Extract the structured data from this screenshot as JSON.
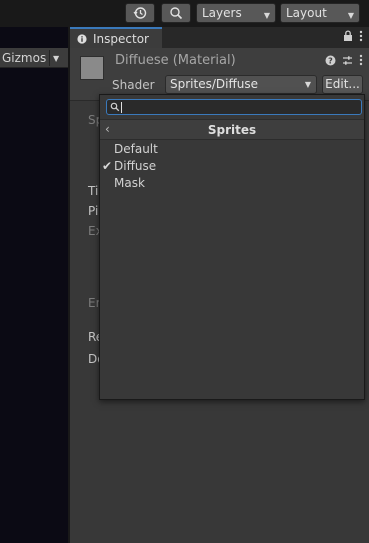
{
  "toolbar": {
    "layers_label": "Layers",
    "layout_label": "Layout"
  },
  "scene": {
    "gizmos_label": "Gizmos"
  },
  "inspector": {
    "tab_label": "Inspector",
    "material_title": "Diffuese (Material)",
    "shader_label": "Shader",
    "shader_value": "Sprites/Diffuse",
    "edit_label": "Edit..."
  },
  "body_labels": {
    "l1": "Sp",
    "l2": "Ti",
    "l3": "Pi",
    "l4": "Ex",
    "l5": "Er",
    "l6": "Re",
    "l7": "Do"
  },
  "shader_popup": {
    "search_value": "",
    "title": "Sprites",
    "items": [
      {
        "label": "Default",
        "checked": false
      },
      {
        "label": "Diffuse",
        "checked": true
      },
      {
        "label": "Mask",
        "checked": false
      }
    ]
  },
  "colors": {
    "accent": "#3a79bb",
    "panel": "#383838",
    "toolbar": "#191919"
  }
}
